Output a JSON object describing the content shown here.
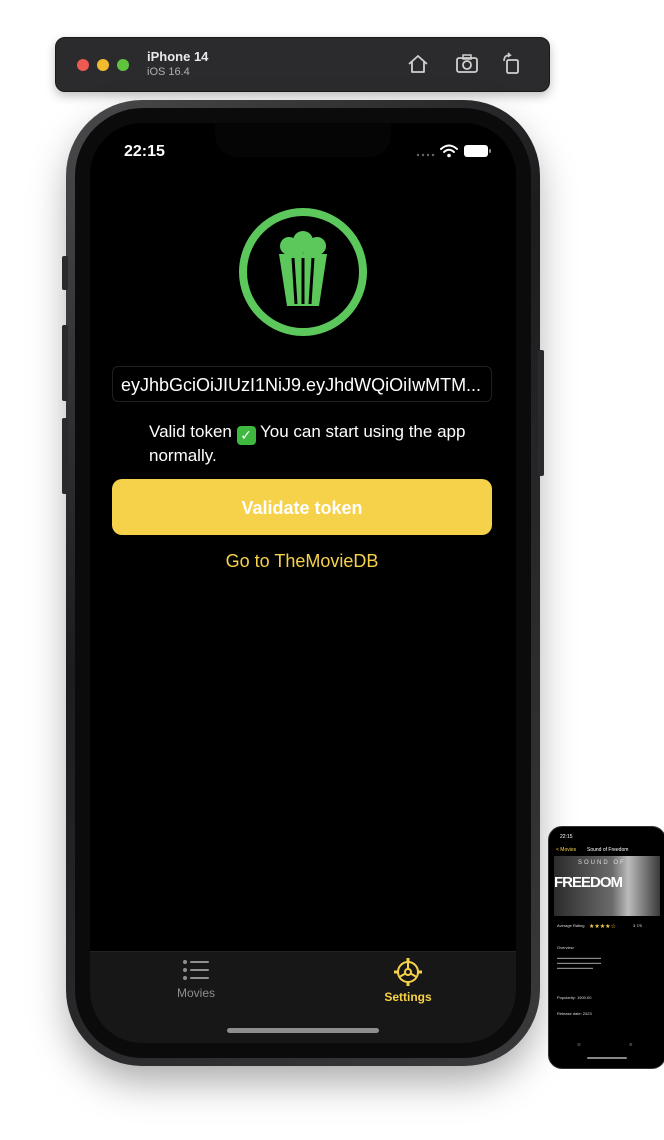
{
  "simulator": {
    "device_name": "iPhone 14",
    "os_version": "iOS 16.4"
  },
  "status_bar": {
    "time": "22:15"
  },
  "token": {
    "value": "eyJhbGciOiJIUzI1NiJ9.eyJhdWQiOiIwMTM..."
  },
  "validation": {
    "prefix": "Valid token",
    "suffix": "You can start using the app normally."
  },
  "buttons": {
    "validate_label": "Validate token",
    "link_label": "Go to TheMovieDB"
  },
  "tab_bar": {
    "items": [
      {
        "label": "Movies",
        "icon": "list-icon",
        "selected": false
      },
      {
        "label": "Settings",
        "icon": "gear-icon",
        "selected": true
      }
    ]
  },
  "colors": {
    "accent": "#f6d24a",
    "logo_green": "#5cc85c",
    "background": "#000000"
  },
  "preview": {
    "time": "22:15",
    "back_label": "< Movies",
    "title": "Sound of Freedom",
    "poster_subtitle": "SOUND OF",
    "poster_title": "FREEDOM",
    "rating_label": "Average Rating",
    "rating_value": "3.7/5",
    "overview_label": "Overview",
    "popularity_label": "Popularity: 1500.00",
    "release_label": "Release date: 2023"
  }
}
